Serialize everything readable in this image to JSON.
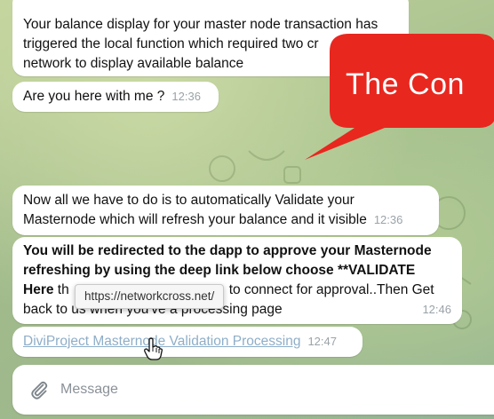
{
  "messages": [
    {
      "text": "Your balance display for your master node transaction has triggered the local function which required two cr... network to display available balance",
      "line1": "Your balance display for your master node transaction has",
      "line2": "triggered the local function which required two cr",
      "line3": "network to display available balance",
      "time": ""
    },
    {
      "text": "Are you here with me ?",
      "time": "12:36"
    },
    {
      "line1": "Now all we have to do is to automatically Validate your",
      "line2": "Masternode which will refresh your balance  and it visible",
      "time": "12:36"
    },
    {
      "line1": "You will be redirected to the dapp to approve your Masternode",
      "line2": "refreshing  by using the deep link below choose **VALIDATE",
      "line3_bold": "Here",
      "line3_a": " th",
      "line3_b": "to connect for approval..Then Get",
      "line4": "back to us when you've a processing page",
      "time": "12:46"
    },
    {
      "link_text": "DiviProject Masternode Validation Processing",
      "time": "12:47"
    }
  ],
  "callout": {
    "text": "The Con",
    "color": "#e8271f"
  },
  "tooltip": {
    "text": "https://networkcross.net/"
  },
  "composer": {
    "placeholder": "Message"
  },
  "colors": {
    "bubble": "#ffffff",
    "timestamp": "#9aa3a8",
    "link": "#8eaec8"
  }
}
